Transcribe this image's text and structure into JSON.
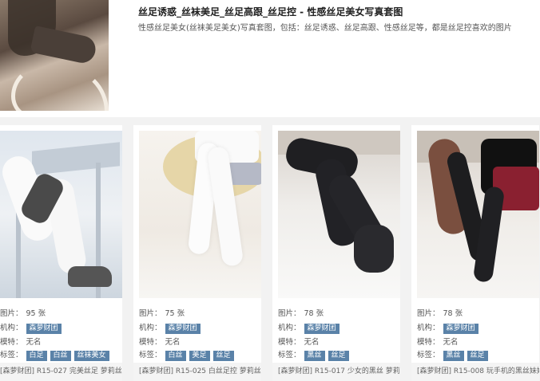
{
  "hero": {
    "title": "丝足诱惑_丝袜美足_丝足高跟_丝足控 - 性感丝足美女写真套图",
    "description": "性感丝足美女(丝袜美足美女)写真套图，包括：丝足诱惑、丝足高跟、性感丝足等，都是丝足控喜欢的图片"
  },
  "labels": {
    "count": "图片：",
    "org": "机构：",
    "model": "模特：",
    "tags": "标签："
  },
  "cards": [
    {
      "count": "95 张",
      "org": "森萝财团",
      "model": "无名",
      "tags": [
        "白足",
        "白丝",
        "丝袜美女"
      ],
      "caption": "[森萝财团] R15-027 完美丝足 萝莉丝"
    },
    {
      "count": "75 张",
      "org": "森萝财团",
      "model": "无名",
      "tags": [
        "白丝",
        "美足",
        "丝足"
      ],
      "caption": "[森萝财团] R15-025 白丝足控 萝莉丝"
    },
    {
      "count": "78 张",
      "org": "森萝财团",
      "model": "无名",
      "tags": [
        "黑丝",
        "丝足"
      ],
      "caption": "[森萝财团] R15-017 少女的黑丝 萝莉"
    },
    {
      "count": "78 张",
      "org": "森萝财团",
      "model": "无名",
      "tags": [
        "黑丝",
        "丝足"
      ],
      "caption": "[森萝财团] R15-008 玩手机的黑丝妹妹"
    }
  ]
}
